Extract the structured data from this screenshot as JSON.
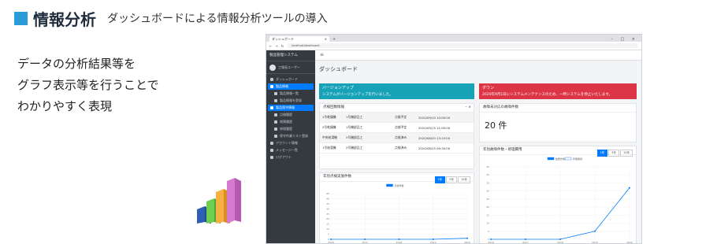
{
  "heading": {
    "title": "情報分析",
    "subtitle": "ダッシュボードによる情報分析ツールの導入"
  },
  "description": [
    "データの分析結果等を",
    "グラフ表示等を行うことで",
    "わかりやすく表現"
  ],
  "colors": {
    "accent": "#2a9bd6",
    "sidebar": "#343a40",
    "info": "#17a2b8",
    "danger": "#dc3545",
    "primary": "#007bff"
  },
  "browser": {
    "tab_title": "ダッシュボード",
    "url": "localhost/dashboard"
  },
  "app": {
    "brand": "製品管理システム",
    "user": "工場長ユーザー",
    "nav": [
      {
        "label": "ダッシュボード",
        "icon": "dashboard-icon"
      },
      {
        "label": "製品情報",
        "icon": "box-icon",
        "active": true
      },
      {
        "label": "製品情報一覧",
        "icon": "list-icon",
        "sub": true
      },
      {
        "label": "製品情報を登録",
        "icon": "plus-icon",
        "sub": true
      },
      {
        "label": "製品保守情報",
        "icon": "wrench-icon",
        "active": true
      },
      {
        "label": "点検履歴",
        "icon": "check-icon",
        "sub": true
      },
      {
        "label": "故障履歴",
        "icon": "alert-icon",
        "sub": true
      },
      {
        "label": "修理履歴",
        "icon": "tool-icon",
        "sub": true
      },
      {
        "label": "保守作業リスト登録",
        "icon": "plus-icon",
        "sub": true
      },
      {
        "label": "アカウント情報",
        "icon": "user-icon"
      },
      {
        "label": "メッセージ一覧",
        "icon": "mail-icon"
      },
      {
        "label": "ログアウト",
        "icon": "logout-icon"
      }
    ],
    "page_title": "ダッシュボード",
    "alert_info": {
      "title": "バージョンアップ",
      "text": "システムがバージョンアップを行いました。"
    },
    "alert_danger": {
      "title": "ダウン",
      "text": "2020年9月1日にシステムメンテナンスのため、一時システムを停止いたします。"
    },
    "table_card": {
      "title": "点検回数情報",
      "rows": [
        [
          "1号乾燥機",
          "1号機部品工",
          "点検予定",
          "2020/09/10 10:00:00"
        ],
        [
          "2号乾燥機",
          "1号機部品工",
          "点検予定",
          "2020/09/15 11:00:00"
        ],
        [
          "中央給湯機",
          "2号機部品工",
          "点検済み",
          "2020/08/20 13:15:00"
        ],
        [
          "1号給湯機",
          "2号機部品工",
          "点検済み",
          "2020/08/25 09:30:00"
        ]
      ]
    },
    "stat_card": {
      "title": "故障未対応の故障件数",
      "value": "20 件"
    },
    "chart_left": {
      "title": "年別点検実施件数",
      "tabs": [
        "1年",
        "5年",
        "10年"
      ],
      "legend": "点検件数"
    },
    "chart_right": {
      "title": "年別故障件数・修理費用",
      "tabs": [
        "1年",
        "5年",
        "10年"
      ],
      "legend": [
        "故障件数",
        "修理費用"
      ]
    }
  },
  "chart_data": [
    {
      "type": "line",
      "x": [
        "2016",
        "2017",
        "2018",
        "2019",
        "2020"
      ],
      "series": [
        {
          "name": "点検件数",
          "values": [
            0,
            0,
            0,
            0,
            1
          ]
        }
      ],
      "ylim": [
        0,
        45
      ]
    },
    {
      "type": "line",
      "x": [
        "2016",
        "2017",
        "2018",
        "2019",
        "2020"
      ],
      "series": [
        {
          "name": "故障件数",
          "values": [
            0,
            0,
            0,
            5,
            32
          ]
        }
      ],
      "ylim": [
        0,
        45
      ]
    }
  ]
}
